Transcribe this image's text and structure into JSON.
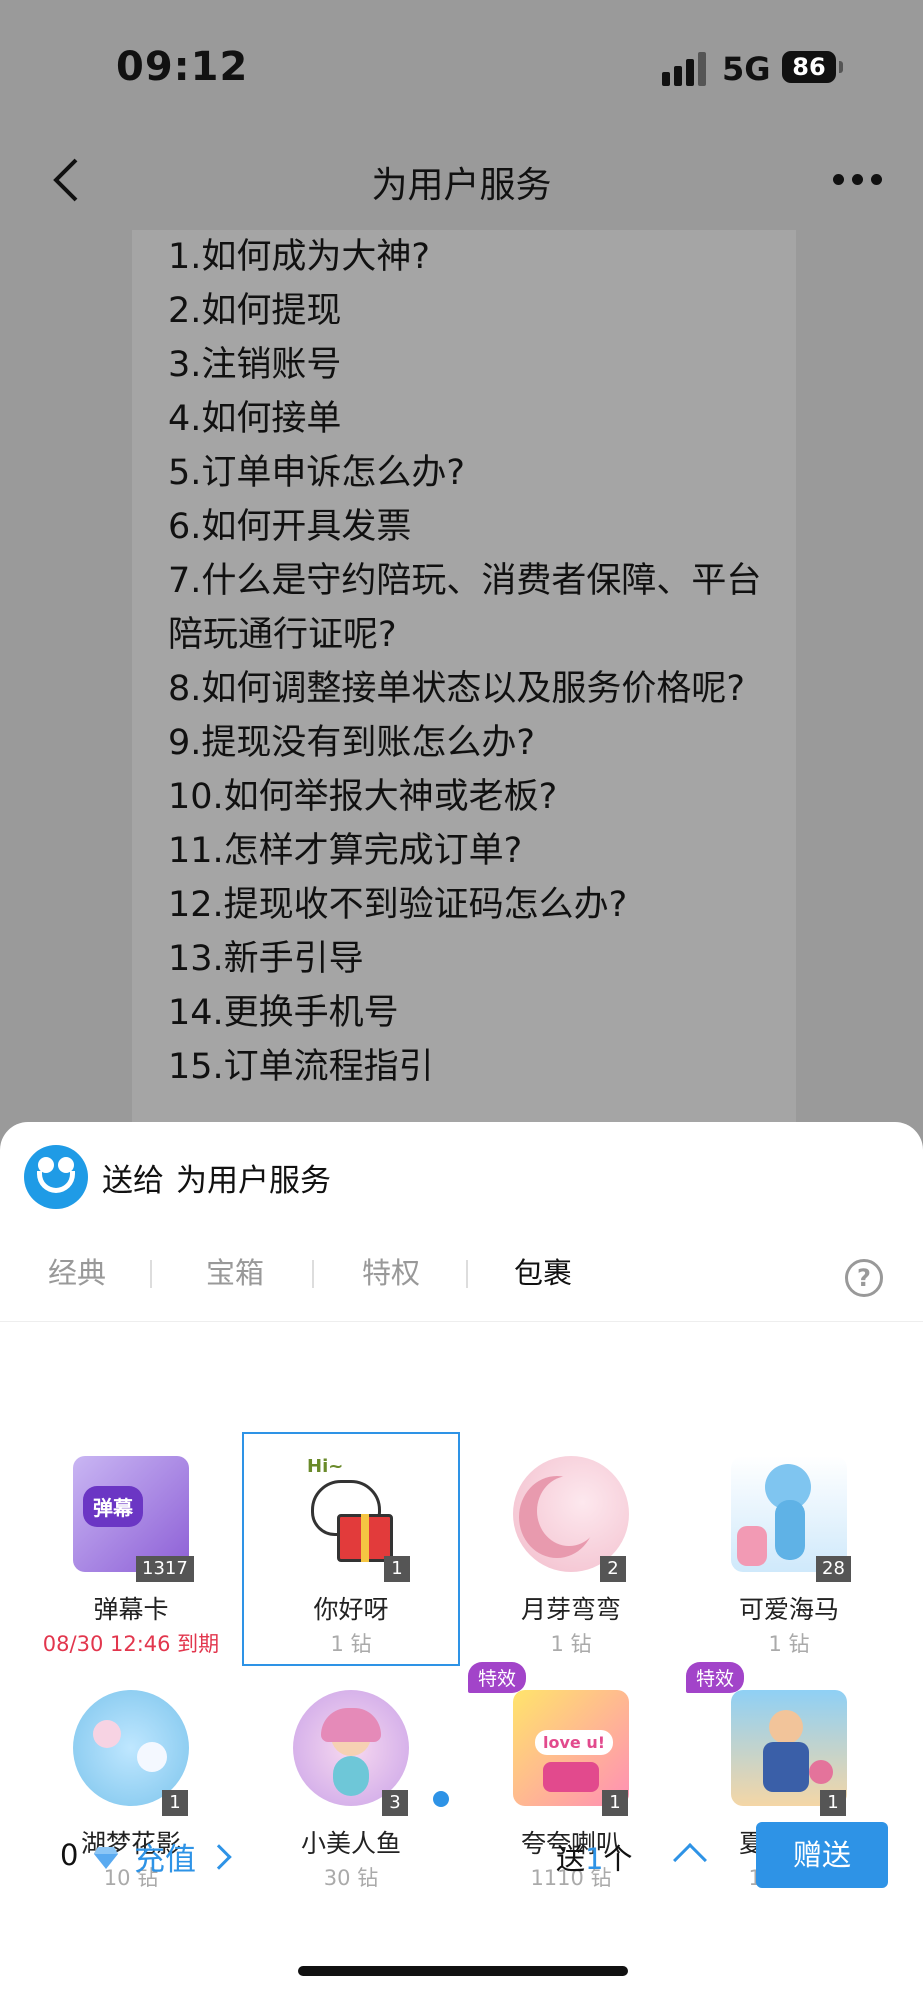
{
  "status_bar": {
    "time": "09:12",
    "network": "5G",
    "battery": "86"
  },
  "nav": {
    "title": "为用户服务"
  },
  "faq": [
    "1.如何成为大神?",
    "2.如何提现",
    "3.注销账号",
    "4.如何接单",
    "5.订单申诉怎么办?",
    "6.如何开具发票",
    "7.什么是守约陪玩、消费者保障、平台陪玩通行证呢?",
    "8.如何调整接单状态以及服务价格呢?",
    "9.提现没有到账怎么办?",
    "10.如何举报大神或老板?",
    "11.怎样才算完成订单?",
    "12.提现收不到验证码怎么办?",
    "13.新手引导",
    "14.更换手机号",
    "15.订单流程指引"
  ],
  "sheet": {
    "send_label": "送给",
    "recipient": "为用户服务",
    "tabs": [
      "经典",
      "宝箱",
      "特权",
      "包裹"
    ],
    "active_tab": "包裹",
    "help": "?"
  },
  "gifts": [
    {
      "name": "弹幕卡",
      "count": "1317",
      "sub": "08/30 12:46 到期",
      "badge": "",
      "img_text": "弹幕"
    },
    {
      "name": "你好呀",
      "count": "1",
      "sub": "1 钻",
      "badge": "",
      "img_text": "Hi~"
    },
    {
      "name": "月芽弯弯",
      "count": "2",
      "sub": "1 钻",
      "badge": "",
      "img_text": ""
    },
    {
      "name": "可爱海马",
      "count": "28",
      "sub": "1 钻",
      "badge": "",
      "img_text": ""
    },
    {
      "name": "湖梦花影",
      "count": "1",
      "sub": "10 钻",
      "badge": "",
      "img_text": ""
    },
    {
      "name": "小美人鱼",
      "count": "3",
      "sub": "30 钻",
      "badge": "",
      "img_text": ""
    },
    {
      "name": "夸夸喇叭",
      "count": "1",
      "sub": "1110 钻",
      "badge": "特效",
      "img_text": "love u!"
    },
    {
      "name": "夏日奔赴",
      "count": "1",
      "sub": "1110 钻",
      "badge": "特效",
      "img_text": ""
    }
  ],
  "bottom": {
    "balance": "0",
    "recharge": "充值",
    "send_prefix": "送",
    "quantity": "1",
    "unit": "个",
    "send_button": "赠送"
  },
  "colors": {
    "accent": "#2e93e6",
    "expiry": "#e2364d",
    "effect_badge": "#a244c9"
  }
}
